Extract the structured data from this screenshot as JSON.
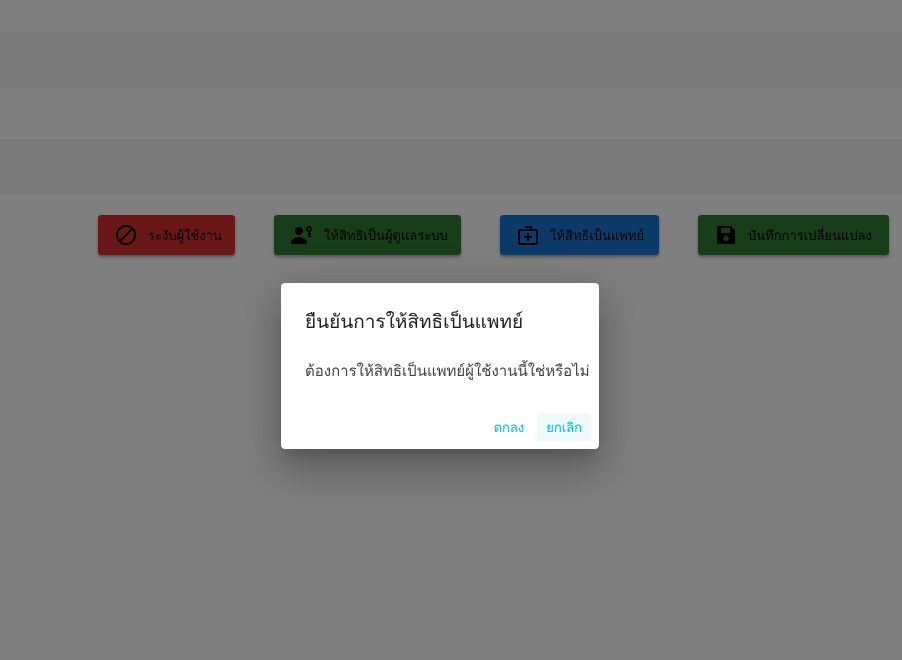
{
  "background": {
    "actions": {
      "suspend_label": "ระงับผู้ใช้งาน",
      "grant_admin_label": "ให้สิทธิเป็นผู้ดูแลระบบ",
      "grant_doctor_label": "ให้สิทธิเป็นแพทย์",
      "save_label": "บันทึกการเปลี่ยนแปลง"
    }
  },
  "dialog": {
    "title": "ยืนยันการให้สิทธิเป็นแพทย์",
    "message": "ต้องการให้สิทธิเป็นแพทย์ผู้ใช้งานนี้ใช่หรือไม่",
    "confirm_label": "ตกลง",
    "cancel_label": "ยกเลิก"
  },
  "colors": {
    "danger": "#d32f2f",
    "success": "#2e7d32",
    "primary": "#1976d2",
    "dialog_action": "#00bcd4",
    "overlay": "rgba(0,0,0,0.5)"
  }
}
